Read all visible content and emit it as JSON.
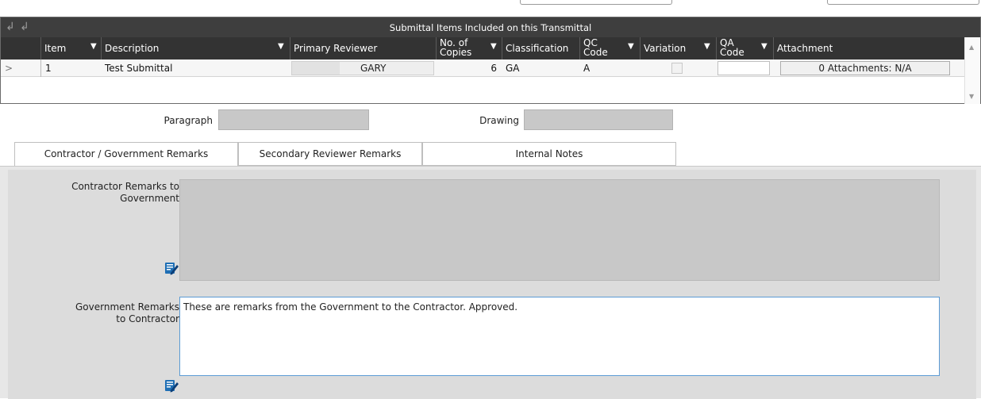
{
  "grid": {
    "title": "Submittal Items Included on this Transmittal",
    "columns": {
      "item": "Item",
      "description": "Description",
      "primary_reviewer": "Primary Reviewer",
      "copies_line1": "No. of",
      "copies_line2": "Copies",
      "classification": "Classification",
      "qc_line1": "QC",
      "qc_line2": "Code",
      "variation": "Variation",
      "qa_line1": "QA",
      "qa_line2": "Code",
      "attachment": "Attachment"
    },
    "rows": [
      {
        "expander": ">",
        "item": "1",
        "description": "Test Submittal",
        "primary_reviewer": "GARY",
        "copies": "6",
        "classification": "GA",
        "qc_code": "A",
        "variation": false,
        "qa_code": "",
        "attachment": "0 Attachments: N/A"
      }
    ]
  },
  "fields": {
    "paragraph_label": "Paragraph",
    "paragraph_value": "",
    "drawing_label": "Drawing",
    "drawing_value": ""
  },
  "tabs": [
    {
      "label": "Contractor / Government Remarks",
      "active": true
    },
    {
      "label": "Secondary Reviewer Remarks",
      "active": false
    },
    {
      "label": "Internal Notes",
      "active": false
    }
  ],
  "remarks": {
    "contractor_label_line1": "Contractor Remarks to",
    "contractor_label_line2": "Government",
    "contractor_value": "",
    "government_label_line1": "Government Remarks",
    "government_label_line2": "to Contractor",
    "government_value": "These are remarks from the Government to the Contractor. Approved."
  },
  "colors": {
    "header_bg": "#333333",
    "title_bg": "#3e3e3e",
    "disabled_field": "#c8c8c8",
    "focus_border": "#5b9bd5",
    "edit_icon_blue": "#1f6fb5"
  }
}
